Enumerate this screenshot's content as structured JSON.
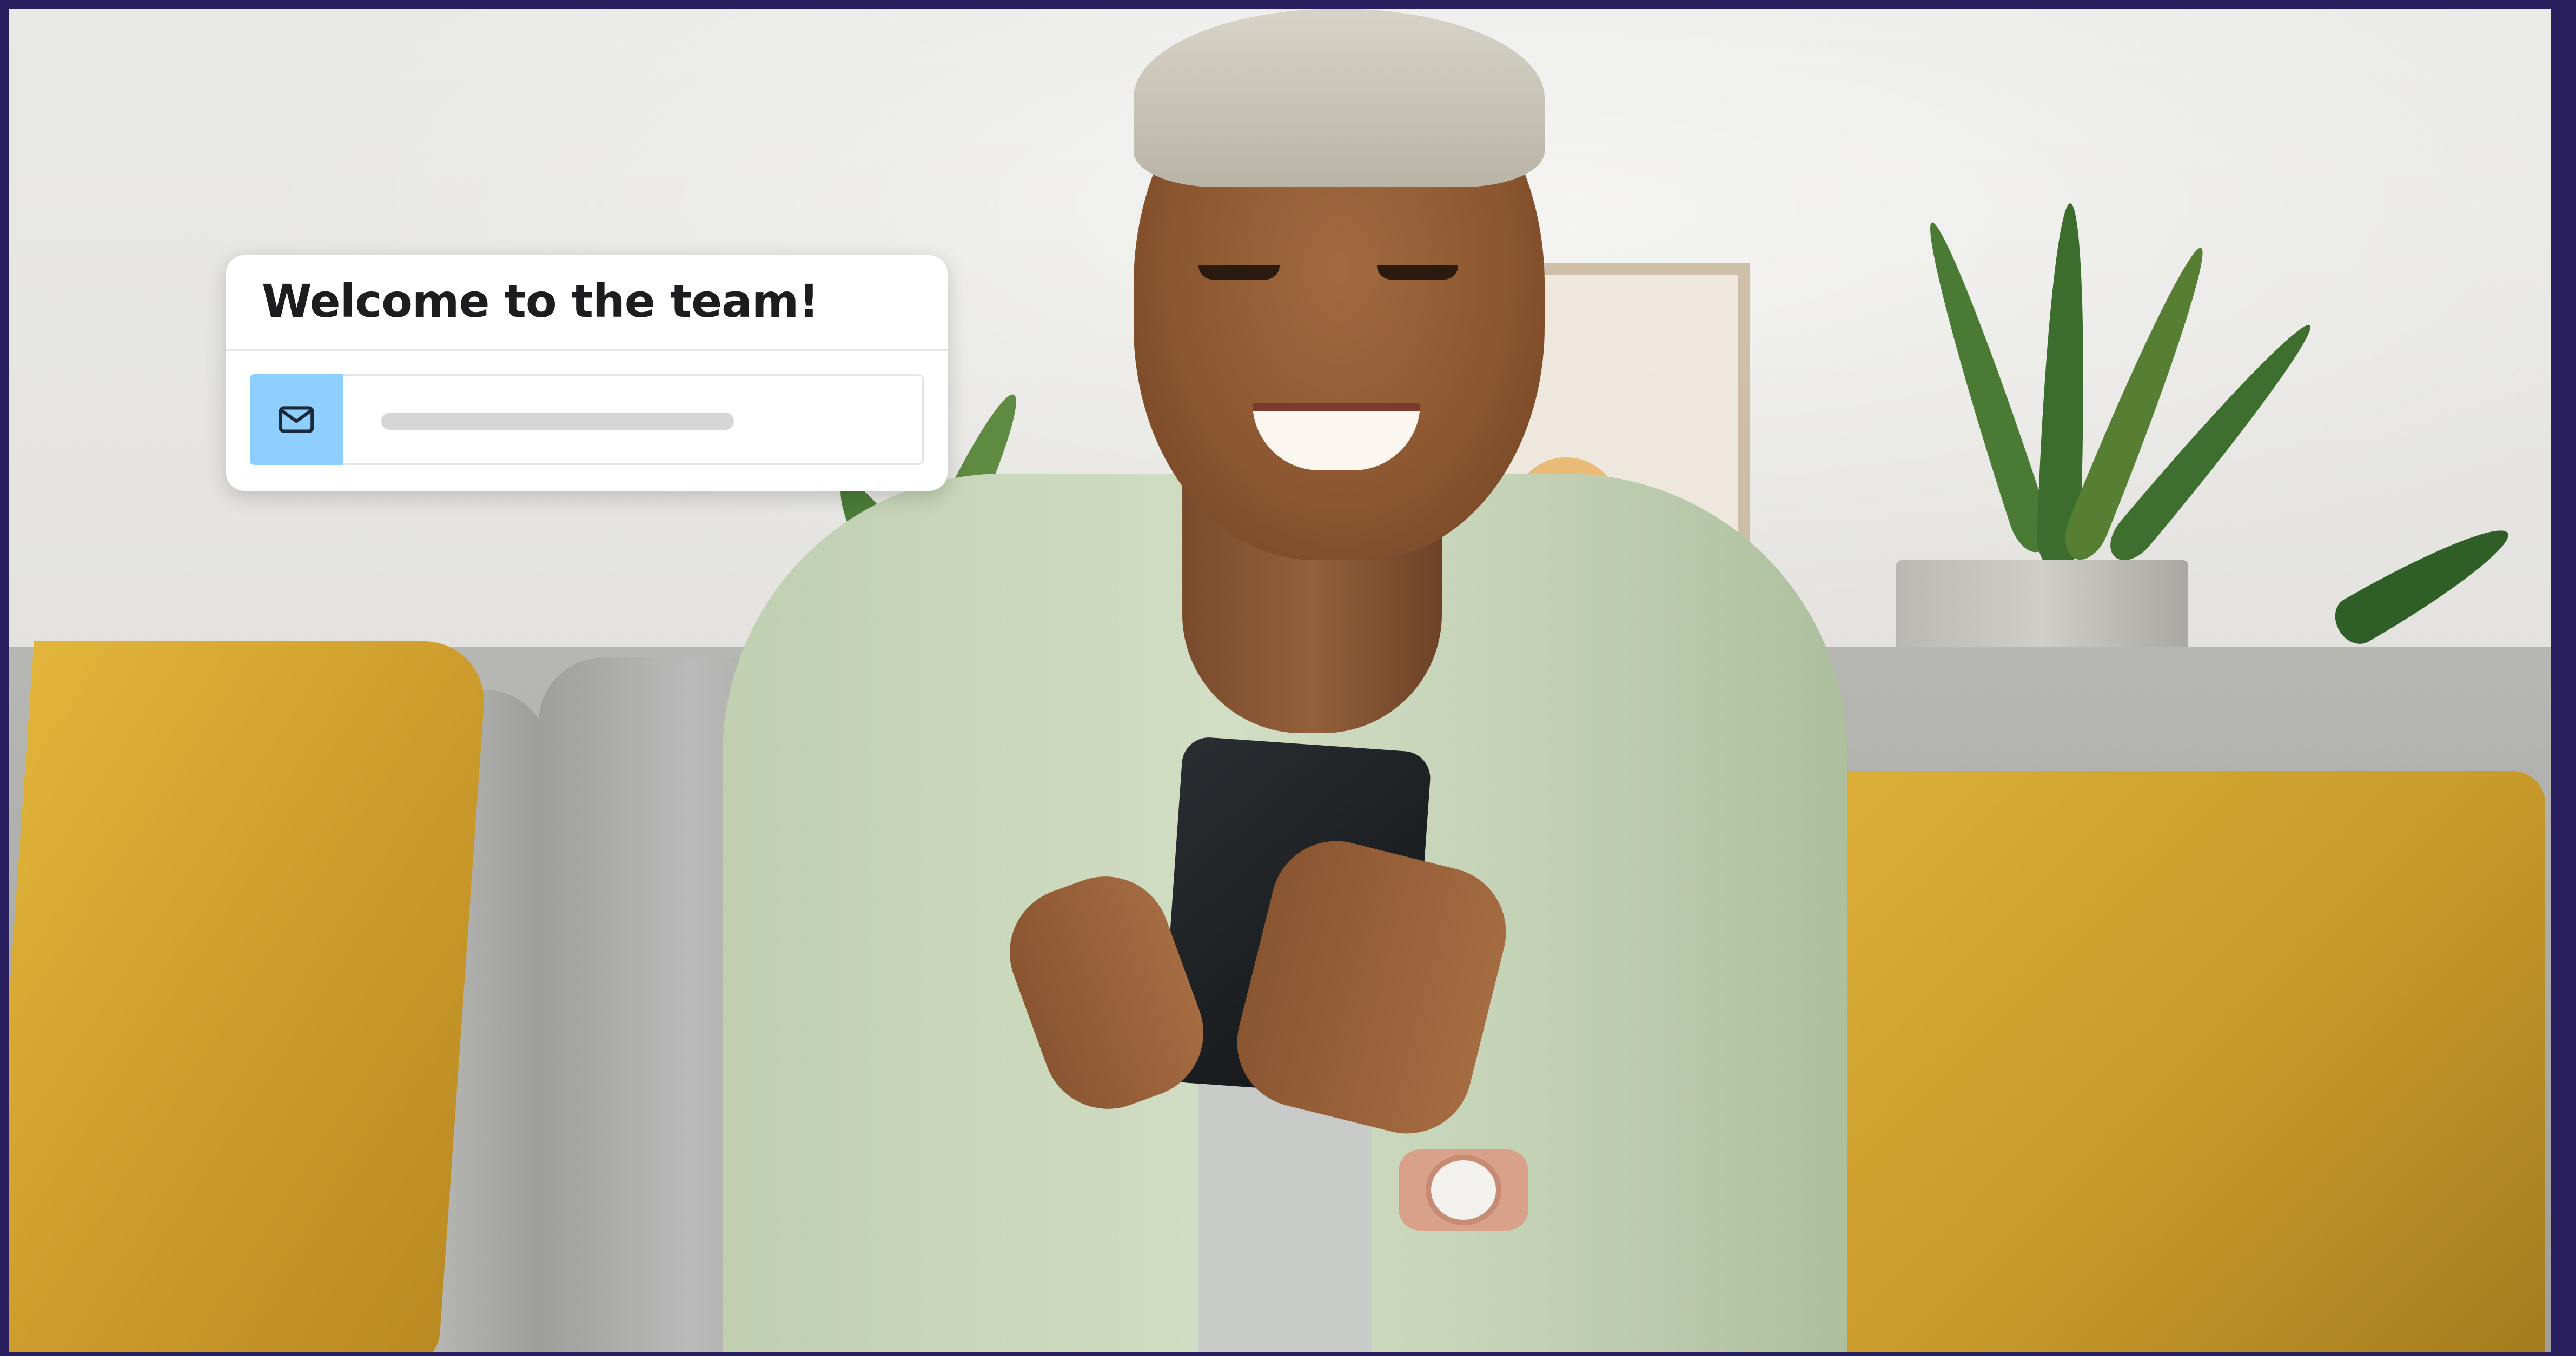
{
  "card": {
    "title": "Welcome to the team!",
    "icon": "mail-icon"
  },
  "colors": {
    "frame_border": "#2a1f5e",
    "icon_background": "#8fcfff",
    "card_background": "#ffffff",
    "placeholder_bar": "#d6d6d6"
  }
}
